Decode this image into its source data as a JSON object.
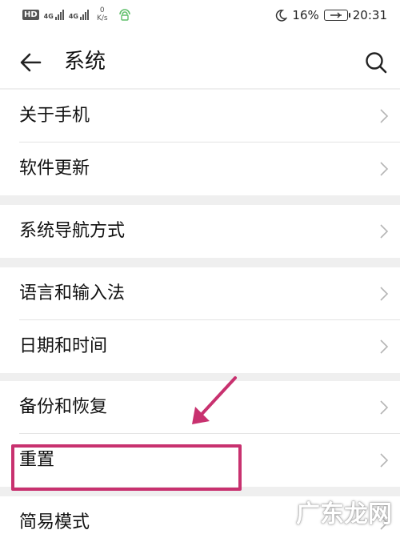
{
  "status_bar": {
    "hd": "HD",
    "sim1": "4G",
    "sim2": "4G",
    "speed_value": "0",
    "speed_unit": "K/s",
    "battery": "16%",
    "time": "20:31"
  },
  "header": {
    "title": "系统"
  },
  "groups": [
    {
      "items": [
        {
          "label": "关于手机"
        },
        {
          "label": "软件更新"
        }
      ]
    },
    {
      "items": [
        {
          "label": "系统导航方式"
        }
      ]
    },
    {
      "items": [
        {
          "label": "语言和输入法"
        },
        {
          "label": "日期和时间"
        }
      ]
    },
    {
      "items": [
        {
          "label": "备份和恢复"
        },
        {
          "label": "重置"
        }
      ]
    },
    {
      "items": [
        {
          "label": "简易模式"
        }
      ]
    }
  ],
  "watermark": "广东龙网",
  "colors": {
    "annotation": "#c8316f",
    "section_gap": "#efefef"
  }
}
